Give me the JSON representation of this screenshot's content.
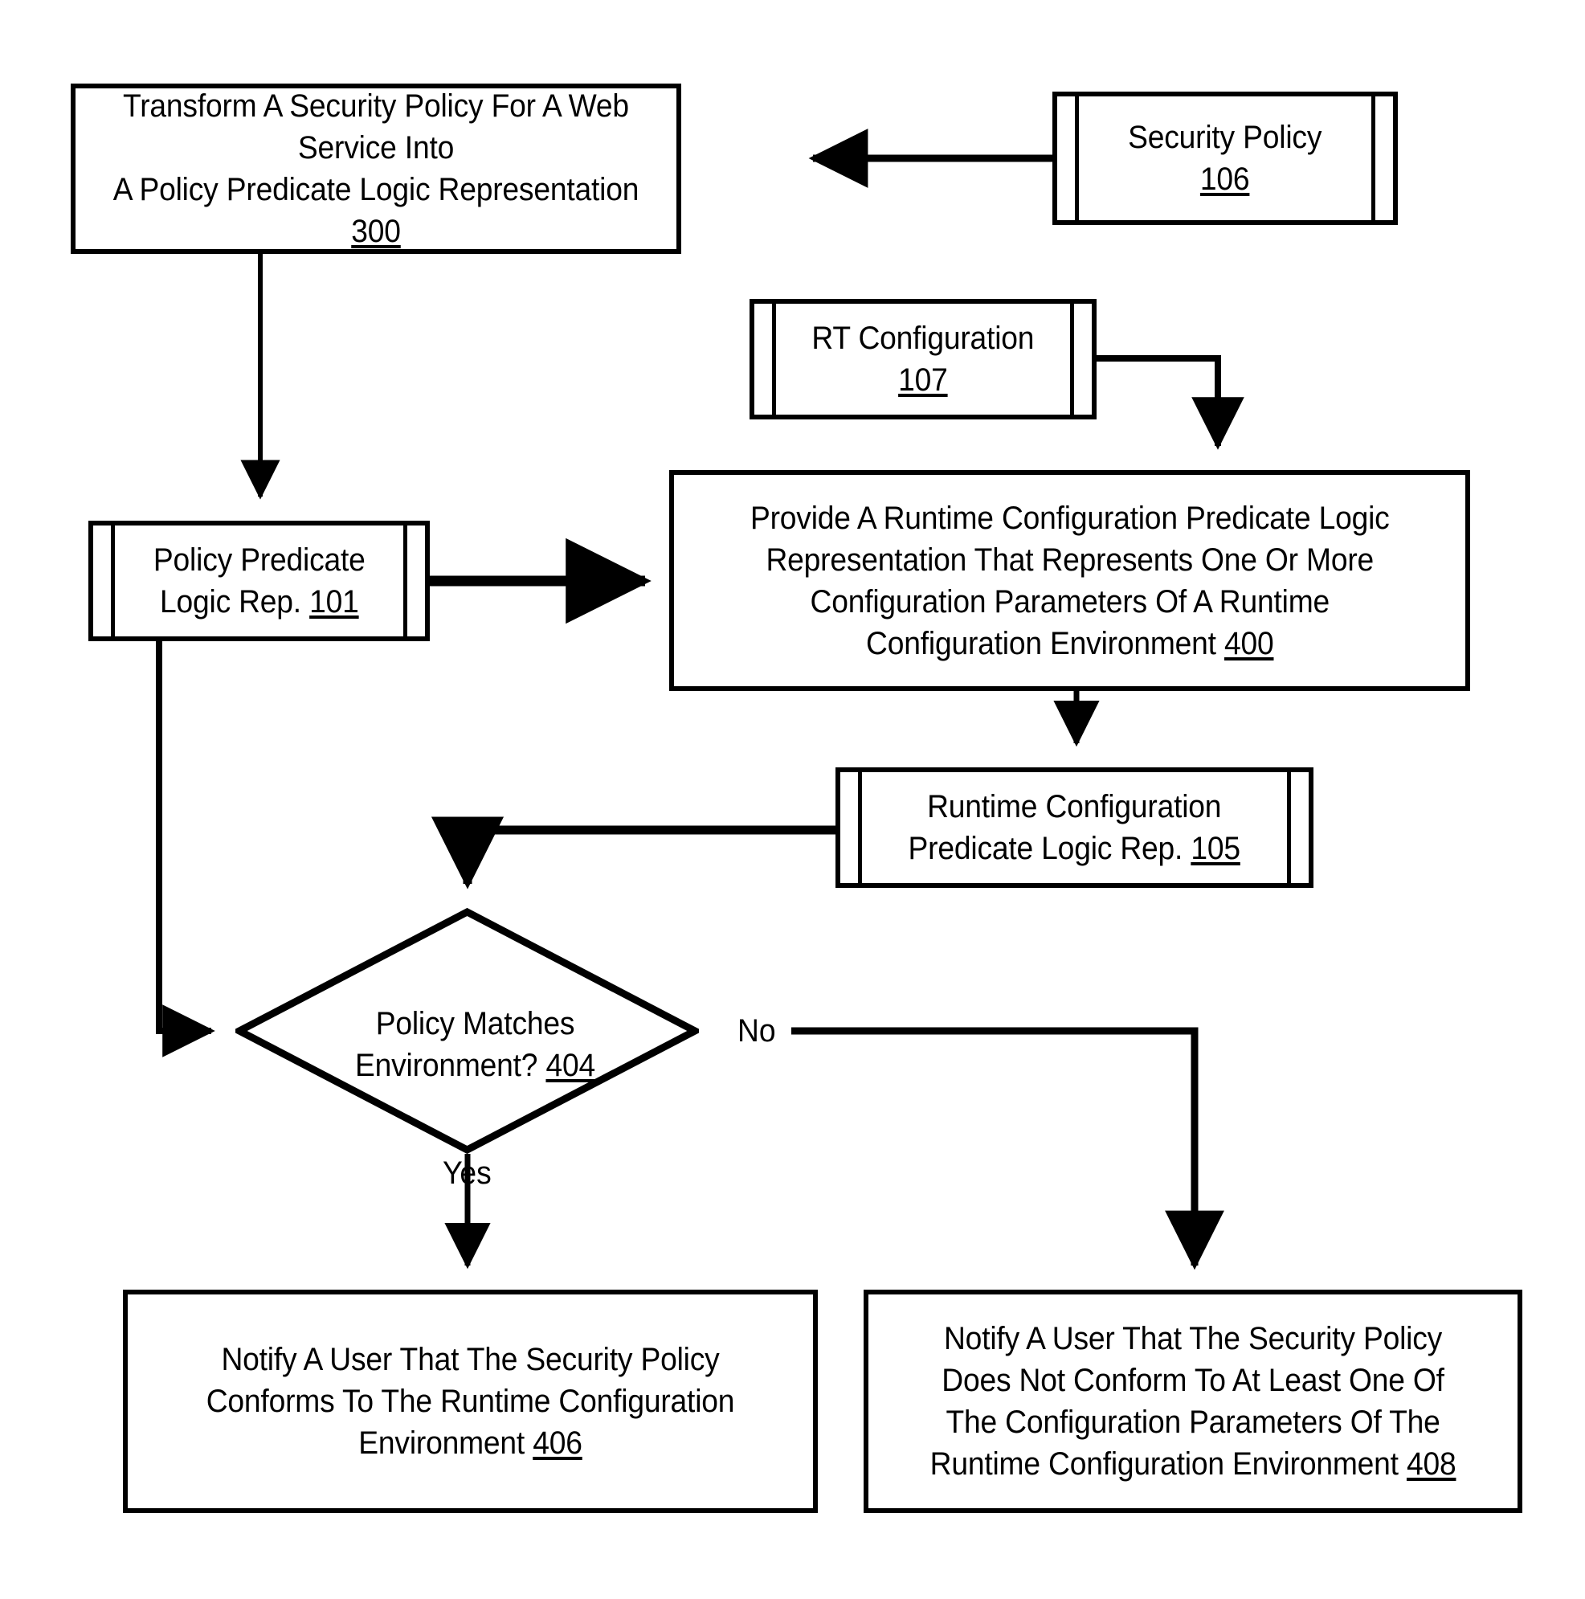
{
  "figure": {
    "type": "flowchart",
    "background_color": "#ffffff",
    "line_color": "#000000",
    "text_color": "#000000"
  },
  "nodes": {
    "transform_policy": {
      "shape": "process",
      "text": "Transform A Security Policy For A Web Service Into\nA Policy Predicate Logic Representation ",
      "ref": "300"
    },
    "security_policy": {
      "shape": "data-store",
      "text": "Security Policy\n",
      "ref": "106"
    },
    "rt_configuration": {
      "shape": "data-store",
      "text": "RT Configuration\n",
      "ref": "107"
    },
    "policy_predicate_logic_rep": {
      "shape": "data-store",
      "text": "Policy Predicate\nLogic Rep. ",
      "ref": "101"
    },
    "provide_runtime_config": {
      "shape": "process",
      "text": "Provide A Runtime Configuration Predicate Logic\nRepresentation That Represents One Or More\nConfiguration Parameters Of A Runtime\nConfiguration Environment ",
      "ref": "400"
    },
    "runtime_config_predicate_logic_rep": {
      "shape": "data-store",
      "text": "Runtime Configuration\nPredicate Logic Rep. ",
      "ref": "105"
    },
    "policy_matches_environment": {
      "shape": "decision",
      "text": "Policy Matches\nEnvironment? ",
      "ref": "404"
    },
    "notify_conforms": {
      "shape": "process",
      "text": "Notify A User That The Security Policy\nConforms To The Runtime Configuration\nEnvironment ",
      "ref": "406"
    },
    "notify_does_not_conform": {
      "shape": "process",
      "text": "Notify A User That The Security Policy\nDoes Not Conform To At Least One Of\nThe Configuration Parameters Of The\nRuntime Configuration Environment ",
      "ref": "408"
    }
  },
  "edge_labels": {
    "no": "No",
    "yes": "Yes"
  },
  "edges": [
    {
      "from": "security_policy",
      "to": "transform_policy",
      "label": ""
    },
    {
      "from": "transform_policy",
      "to": "policy_predicate_logic_rep",
      "label": ""
    },
    {
      "from": "rt_configuration",
      "to": "provide_runtime_config",
      "label": ""
    },
    {
      "from": "policy_predicate_logic_rep",
      "to": "provide_runtime_config",
      "label": ""
    },
    {
      "from": "provide_runtime_config",
      "to": "runtime_config_predicate_logic_rep",
      "label": ""
    },
    {
      "from": "runtime_config_predicate_logic_rep",
      "to": "policy_matches_environment",
      "label": ""
    },
    {
      "from": "policy_predicate_logic_rep",
      "to": "policy_matches_environment",
      "label": ""
    },
    {
      "from": "policy_matches_environment",
      "to": "notify_conforms",
      "label": "Yes"
    },
    {
      "from": "policy_matches_environment",
      "to": "notify_does_not_conform",
      "label": "No"
    }
  ]
}
